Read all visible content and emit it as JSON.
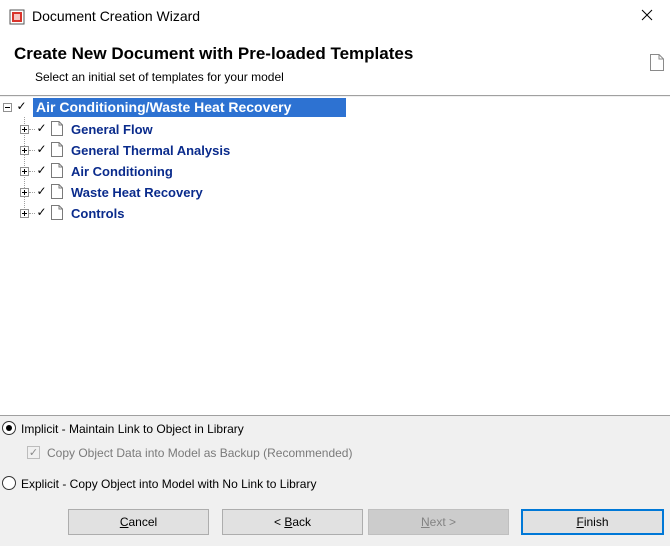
{
  "window": {
    "title": "Document Creation Wizard"
  },
  "header": {
    "title": "Create New Document with Pre-loaded Templates",
    "subtitle": "Select an initial set of templates for your model"
  },
  "tree": {
    "root": {
      "label": "Air Conditioning/Waste Heat Recovery",
      "checked": true,
      "expanded": true
    },
    "items": [
      {
        "label": "General Flow",
        "checked": true
      },
      {
        "label": "General Thermal Analysis",
        "checked": true
      },
      {
        "label": "Air Conditioning",
        "checked": true
      },
      {
        "label": "Waste Heat Recovery",
        "checked": true
      },
      {
        "label": "Controls",
        "checked": true
      }
    ]
  },
  "options": {
    "implicit_label": "Implicit - Maintain Link to Object in Library",
    "implicit_selected": true,
    "copy_backup_label": "Copy Object Data into Model as Backup (Recommended)",
    "copy_backup_checked": true,
    "explicit_label": "Explicit - Copy Object into Model with No Link to Library",
    "explicit_selected": false
  },
  "buttons": {
    "cancel_mnemonic": "C",
    "cancel_rest": "ancel",
    "back_prefix": "< ",
    "back_mnemonic": "B",
    "back_rest": "ack",
    "next_mnemonic": "N",
    "next_rest": "ext >",
    "finish_mnemonic": "F",
    "finish_rest": "inish"
  },
  "colors": {
    "selection": "#2d72d2",
    "tree_text": "#0a2b8c",
    "default_button_border": "#0078d7"
  }
}
